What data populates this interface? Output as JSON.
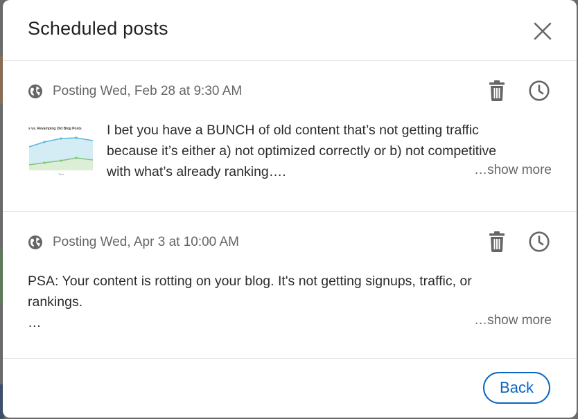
{
  "dialog": {
    "title": "Scheduled posts",
    "close_icon": "close-icon"
  },
  "posts": [
    {
      "schedule_text": "Posting Wed, Feb 28 at 9:30 AM",
      "visibility_icon": "globe-icon",
      "has_thumbnail": true,
      "thumbnail": {
        "title": "s vs. Revamping Old Blog Posts",
        "axis_label": "Time"
      },
      "body_lines": [
        "I bet you have a BUNCH of old content that’s not getting traffic",
        "because it’s either a) not optimized correctly or b) not competitive",
        "with what’s already ranking…."
      ],
      "show_more_label": "…show more"
    },
    {
      "schedule_text": "Posting Wed, Apr 3 at 10:00 AM",
      "visibility_icon": "globe-icon",
      "has_thumbnail": false,
      "body_lines": [
        "PSA: Your content is rotting on your blog. It's not getting signups, traffic, or",
        "rankings.",
        "…"
      ],
      "show_more_label": "…show more"
    }
  ],
  "footer": {
    "back_label": "Back"
  },
  "colors": {
    "accent": "#0a66c2",
    "icon_gray": "#666666",
    "text": "#2b2b2b"
  }
}
